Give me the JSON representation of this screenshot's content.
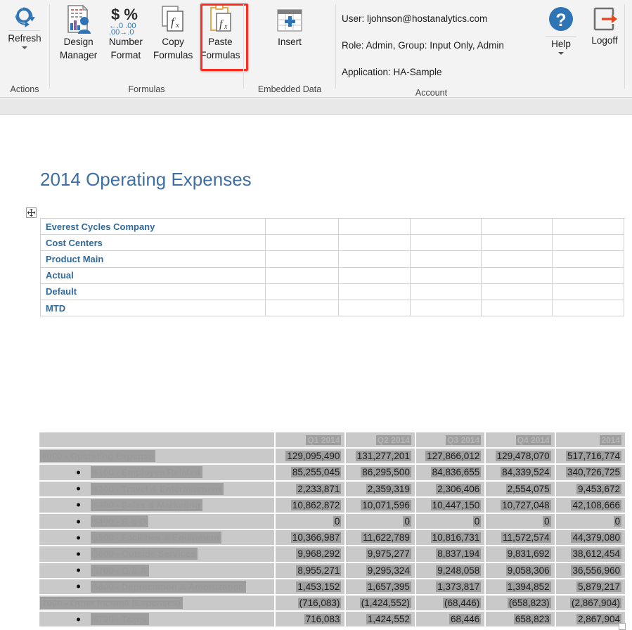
{
  "ribbon": {
    "groups": [
      {
        "name": "actions",
        "label": "Actions"
      },
      {
        "name": "formulas",
        "label": "Formulas"
      },
      {
        "name": "embedded",
        "label": "Embedded Data"
      },
      {
        "name": "account",
        "label": "Account"
      }
    ],
    "actions": {
      "refresh": {
        "label_line1": "Refresh",
        "icon": "refresh-icon",
        "has_dropdown": true
      }
    },
    "formulas": {
      "design_manager": {
        "line1": "Design",
        "line2": "Manager",
        "icon": "design-manager-icon"
      },
      "number_format": {
        "line1": "Number",
        "line2": "Format",
        "icon": "number-format-icon"
      },
      "copy_formulas": {
        "line1": "Copy",
        "line2": "Formulas",
        "icon": "copy-formulas-icon",
        "selected": true
      },
      "paste_formulas": {
        "line1": "Paste",
        "line2": "Formulas",
        "icon": "paste-formulas-icon"
      }
    },
    "embedded": {
      "insert": {
        "label": "Insert",
        "icon": "insert-table-icon"
      }
    },
    "account": {
      "user": "User: ljohnson@hostanalytics.com",
      "role": "Role: Admin, Group: Input Only, Admin",
      "application": "Application: HA-Sample",
      "help": {
        "label": "Help",
        "icon": "help-icon",
        "has_dropdown": true
      },
      "logoff": {
        "label": "Logoff",
        "icon": "logoff-icon"
      }
    },
    "highlight_color": "#ff2d20"
  },
  "sheet": {
    "title": "2014 Operating Expenses",
    "move_handle_icon": "move-cross-icon",
    "meta_rows": [
      {
        "label": "Everest Cycles Company"
      },
      {
        "label": "Cost Centers"
      },
      {
        "label": "Product Main"
      },
      {
        "label": "Actual"
      },
      {
        "label": "Default"
      },
      {
        "label": "MTD"
      }
    ]
  },
  "chart_data": {
    "type": "table",
    "title": "2014 Operating Expenses",
    "columns": [
      "",
      "Q1 2014",
      "Q2 2014",
      "Q3 2014",
      "Q4 2014",
      "2014"
    ],
    "rows": [
      {
        "label": "6000 - Operating Expense",
        "level": 0,
        "values": [
          "129,095,490",
          "131,277,201",
          "127,866,012",
          "129,478,070",
          "517,716,774"
        ]
      },
      {
        "label": "6100 - Employee Related",
        "level": 1,
        "values": [
          "85,255,045",
          "86,295,500",
          "84,836,655",
          "84,339,524",
          "340,726,725"
        ]
      },
      {
        "label": "6200 - Travel & Entertainment",
        "level": 1,
        "values": [
          "2,233,871",
          "2,359,319",
          "2,306,406",
          "2,554,075",
          "9,453,672"
        ]
      },
      {
        "label": "6300 - Sales & Marketing",
        "level": 1,
        "values": [
          "10,862,872",
          "10,071,596",
          "10,447,150",
          "10,727,048",
          "42,108,666"
        ]
      },
      {
        "label": "6400 - R & D",
        "level": 1,
        "values": [
          "0",
          "0",
          "0",
          "0",
          "0"
        ]
      },
      {
        "label": "6500 - Facilities & Equipment",
        "level": 1,
        "values": [
          "10,366,987",
          "11,622,789",
          "10,816,731",
          "11,572,574",
          "44,379,080"
        ]
      },
      {
        "label": "6600 - Outside Services",
        "level": 1,
        "values": [
          "9,968,292",
          "9,975,277",
          "8,837,194",
          "9,831,692",
          "38,612,454"
        ]
      },
      {
        "label": "6700 - G & A",
        "level": 1,
        "values": [
          "8,955,271",
          "9,295,324",
          "9,248,058",
          "9,058,306",
          "36,556,960"
        ]
      },
      {
        "label": "6800 - Depreciation & Amortization",
        "level": 1,
        "values": [
          "1,453,152",
          "1,657,395",
          "1,373,817",
          "1,394,852",
          "5,879,217"
        ]
      },
      {
        "label": "7000 - Other Income (Expenses)",
        "level": 0,
        "values": [
          "(716,083)",
          "(1,424,552)",
          "(68,446)",
          "(658,823)",
          "(2,867,904)"
        ]
      },
      {
        "label": "6790 - Taxes",
        "level": 1,
        "values": [
          "716,083",
          "1,424,552",
          "68,446",
          "658,823",
          "2,867,904"
        ]
      }
    ]
  }
}
